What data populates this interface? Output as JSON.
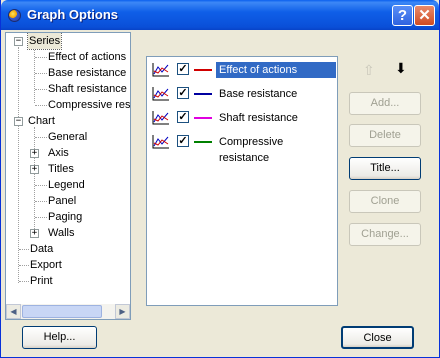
{
  "window": {
    "title": "Graph Options",
    "help_glyph": "?",
    "close_glyph": "✕"
  },
  "tree": {
    "series": {
      "label": "Series",
      "expander": "−",
      "children": [
        "Effect of actions",
        "Base resistance",
        "Shaft resistance",
        "Compressive resi"
      ]
    },
    "chart": {
      "label": "Chart",
      "expander": "−",
      "children": [
        {
          "label": "General",
          "expander": ""
        },
        {
          "label": "Axis",
          "expander": "+"
        },
        {
          "label": "Titles",
          "expander": "+"
        },
        {
          "label": "Legend",
          "expander": ""
        },
        {
          "label": "Panel",
          "expander": ""
        },
        {
          "label": "Paging",
          "expander": ""
        },
        {
          "label": "Walls",
          "expander": "+"
        }
      ]
    },
    "others": [
      "Data",
      "Export",
      "Print"
    ],
    "scroll_left": "◀",
    "scroll_right": "▶"
  },
  "series_list": [
    {
      "label": "Effect of actions",
      "checked": true,
      "color": "#D00000",
      "selected": true
    },
    {
      "label": "Base resistance",
      "checked": true,
      "color": "#0000A0",
      "selected": false
    },
    {
      "label": "Shaft resistance",
      "checked": true,
      "color": "#E000E0",
      "selected": false
    },
    {
      "label": "Compressive resistance",
      "checked": true,
      "color": "#008000",
      "selected": false
    }
  ],
  "check_glyph": "✓",
  "buttons": {
    "move_up": "⇧",
    "move_down": "⬇",
    "add": "Add...",
    "delete": "Delete",
    "title": "Title...",
    "clone": "Clone",
    "change": "Change...",
    "help": "Help...",
    "close": "Close"
  }
}
